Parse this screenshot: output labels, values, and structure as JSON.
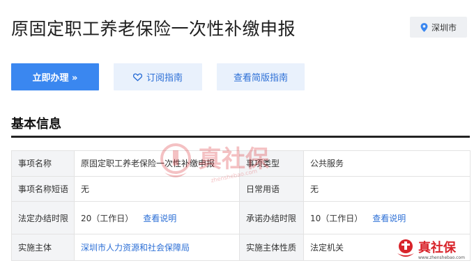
{
  "header": {
    "title": "原固定职工养老保险一次性补缴申报",
    "location": "深圳市"
  },
  "actions": {
    "apply": "立即办理 »",
    "subscribe": "订阅指南",
    "simple_guide": "查看简版指南"
  },
  "section": {
    "title": "基本信息"
  },
  "table": {
    "r1": {
      "l1": "事项名称",
      "v1": "原固定职工养老保险一次性补缴申报",
      "l2": "事项类型",
      "v2": "公共服务"
    },
    "r2": {
      "l1": "事项名称短语",
      "v1": "无",
      "l2": "日常用语",
      "v2": "无"
    },
    "r3": {
      "l1": "法定办结时限",
      "v1": "20（工作日）",
      "link1": "查看说明",
      "l2": "承诺办结时限",
      "v2": "10（工作日）",
      "link2": "查看说明"
    },
    "r4": {
      "l1": "实施主体",
      "v1": "深圳市人力资源和社会保障局",
      "l2": "实施主体性质",
      "v2": "法定机关"
    }
  },
  "watermark": {
    "text": "真社保",
    "url": "zhenshebao.com"
  },
  "colors": {
    "primary": "#3a87f0",
    "secondary_bg": "#e9f1fc",
    "link": "#2c6fd6",
    "brand_red": "#d8232a"
  }
}
